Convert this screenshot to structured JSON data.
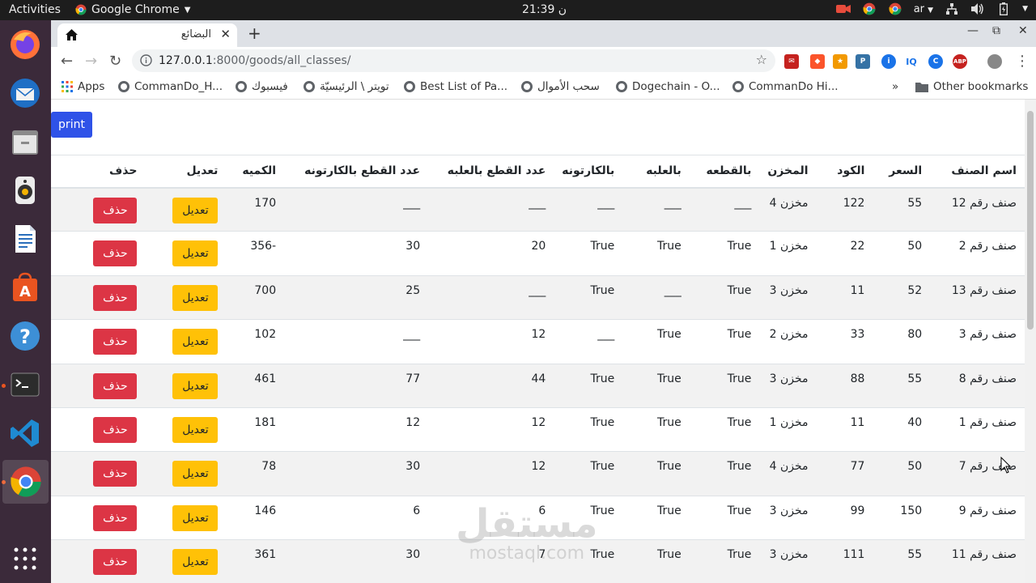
{
  "topbar": {
    "activities": "Activities",
    "app_name": "Google Chrome",
    "clock": "ن 21:39",
    "lang": "ar"
  },
  "chrome": {
    "tab_title": "البضائع",
    "url_host": "127.0.0.1",
    "url_rest": ":8000/goods/all_classes/",
    "bookmarks": [
      {
        "label": "Apps"
      },
      {
        "label": "CommanDo_H..."
      },
      {
        "label": "فيسبوك"
      },
      {
        "label": "تويتر \\ الرئيسيّة"
      },
      {
        "label": "Best List of Pa..."
      },
      {
        "label": "سحب الأموال"
      },
      {
        "label": "Dogechain - O..."
      },
      {
        "label": "CommanDo Hi..."
      }
    ],
    "more_bookmarks": "»",
    "other_bookmarks": "Other bookmarks"
  },
  "page": {
    "print_label": "print",
    "columns": [
      "اسم الصنف",
      "السعر",
      "الكود",
      "المخزن",
      "بالقطعه",
      "بالعلبه",
      "بالكارتونه",
      "عدد القطع بالعلبه",
      "عدد القطع بالكارتونه",
      "الكميه",
      "تعديل",
      "حذف"
    ],
    "edit_label": "تعديل",
    "delete_label": "حذف",
    "rows": [
      [
        "صنف رقم 12",
        "55",
        "122",
        "مخزن 4",
        "___",
        "___",
        "___",
        "___",
        "___",
        "170"
      ],
      [
        "صنف رقم 2",
        "50",
        "22",
        "مخزن 1",
        "True",
        "True",
        "True",
        "20",
        "30",
        "-356"
      ],
      [
        "صنف رقم 13",
        "52",
        "11",
        "مخزن 3",
        "True",
        "___",
        "True",
        "___",
        "25",
        "700"
      ],
      [
        "صنف رقم 3",
        "80",
        "33",
        "مخزن 2",
        "True",
        "True",
        "___",
        "12",
        "___",
        "102"
      ],
      [
        "صنف رقم 8",
        "55",
        "88",
        "مخزن 3",
        "True",
        "True",
        "True",
        "44",
        "77",
        "461"
      ],
      [
        "صنف رقم 1",
        "40",
        "11",
        "مخزن 1",
        "True",
        "True",
        "True",
        "12",
        "12",
        "181"
      ],
      [
        "صنف رقم 7",
        "50",
        "77",
        "مخزن 4",
        "True",
        "True",
        "True",
        "12",
        "30",
        "78"
      ],
      [
        "صنف رقم 9",
        "150",
        "99",
        "مخزن 3",
        "True",
        "True",
        "True",
        "6",
        "6",
        "146"
      ],
      [
        "صنف رقم 11",
        "55",
        "111",
        "مخزن 3",
        "True",
        "True",
        "True",
        "7",
        "30",
        "361"
      ]
    ]
  },
  "watermark": {
    "main": "مستقل",
    "sub": "mostaql.com"
  },
  "colors": {
    "print_button": "#2f52e8",
    "edit_button": "#ffc107",
    "delete_button": "#dc3545",
    "dock": "#3b2a3a"
  }
}
